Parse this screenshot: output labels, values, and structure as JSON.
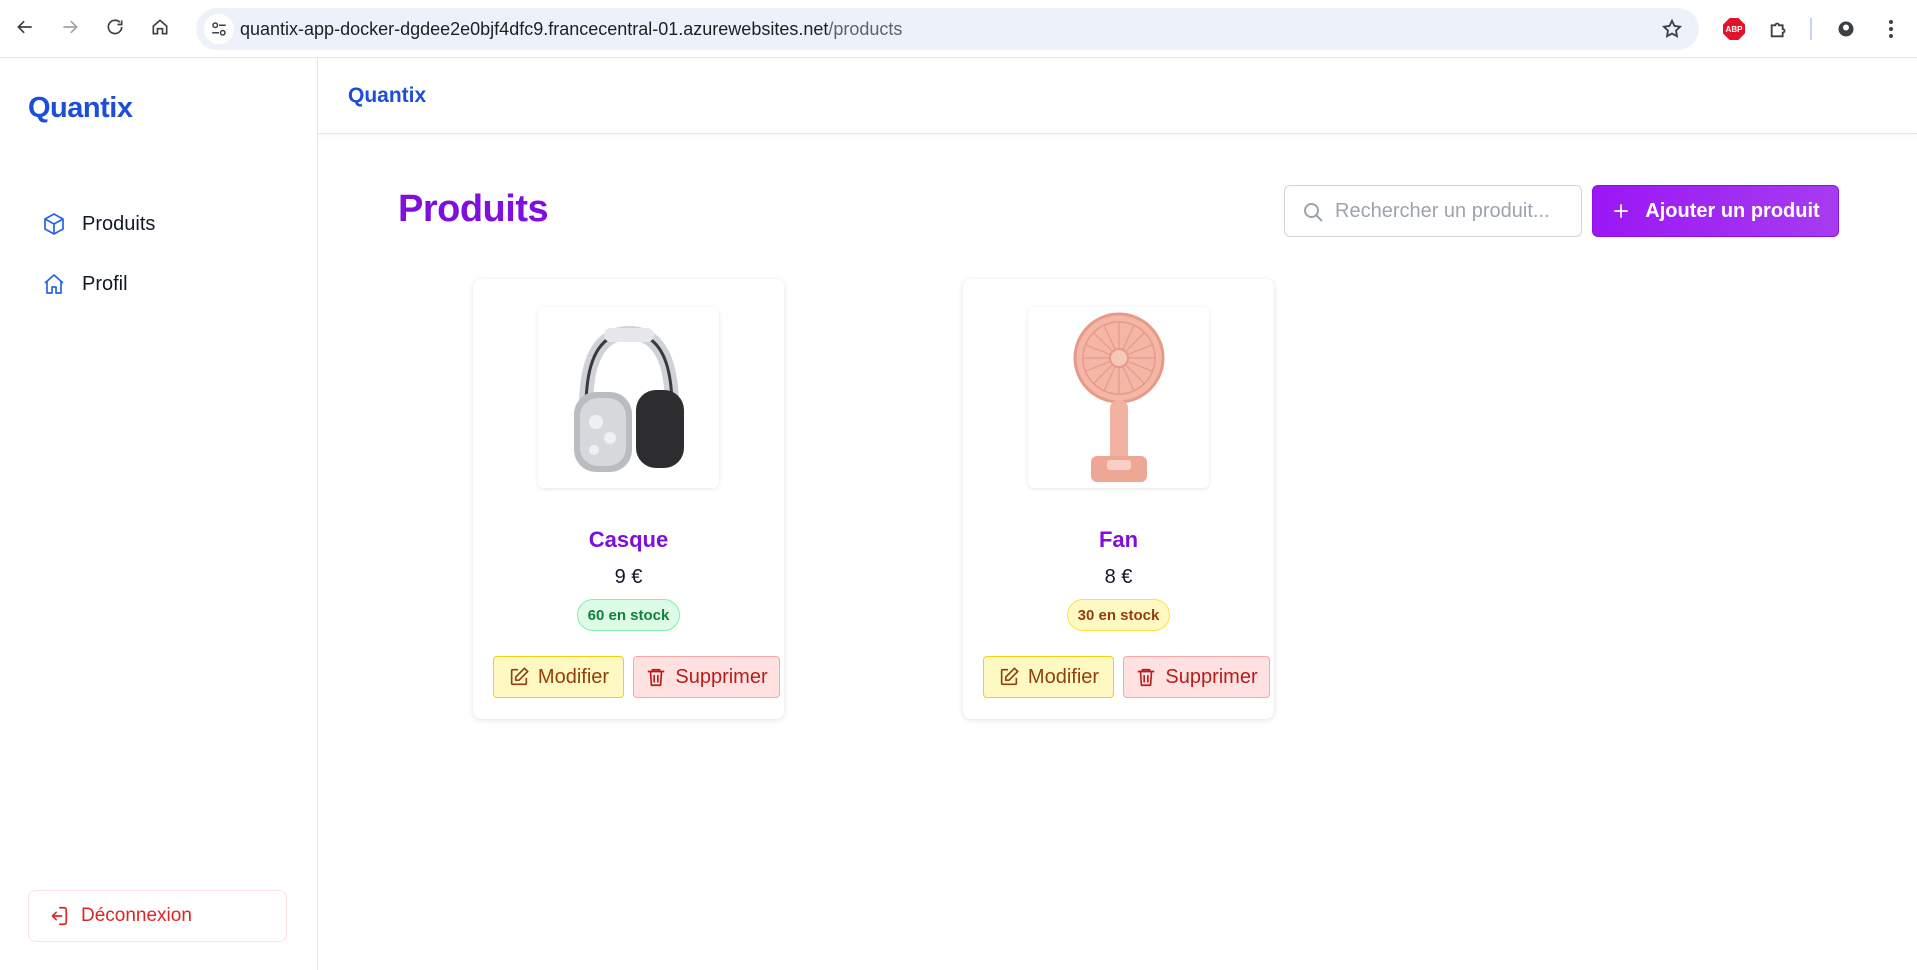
{
  "browser": {
    "url_host": "quantix-app-docker-dgdee2e0bjf4dfc9.francecentral-01.azurewebsites.net",
    "url_path": "/products",
    "extension_abp": "ABP"
  },
  "sidebar": {
    "brand": "Quantix",
    "items": [
      {
        "label": "Produits",
        "icon": "cube-icon"
      },
      {
        "label": "Profil",
        "icon": "home-icon"
      }
    ],
    "logout_label": "Déconnexion"
  },
  "topbar": {
    "title": "Quantix"
  },
  "main": {
    "title": "Produits",
    "search_placeholder": "Rechercher un produit...",
    "add_button_label": "Ajouter un produit"
  },
  "products": [
    {
      "name": "Casque",
      "price": "9 €",
      "stock": "60 en stock",
      "stock_color": "green",
      "image": "headphones-image",
      "edit_label": "Modifier",
      "delete_label": "Supprimer"
    },
    {
      "name": "Fan",
      "price": "8 €",
      "stock": "30 en stock",
      "stock_color": "yellow",
      "image": "fan-image",
      "edit_label": "Modifier",
      "delete_label": "Supprimer"
    }
  ],
  "colors": {
    "brand_blue": "#1d4ed8",
    "accent_purple": "#7e0fdc",
    "button_purple": "#9b17f5",
    "danger": "#dc2626"
  }
}
